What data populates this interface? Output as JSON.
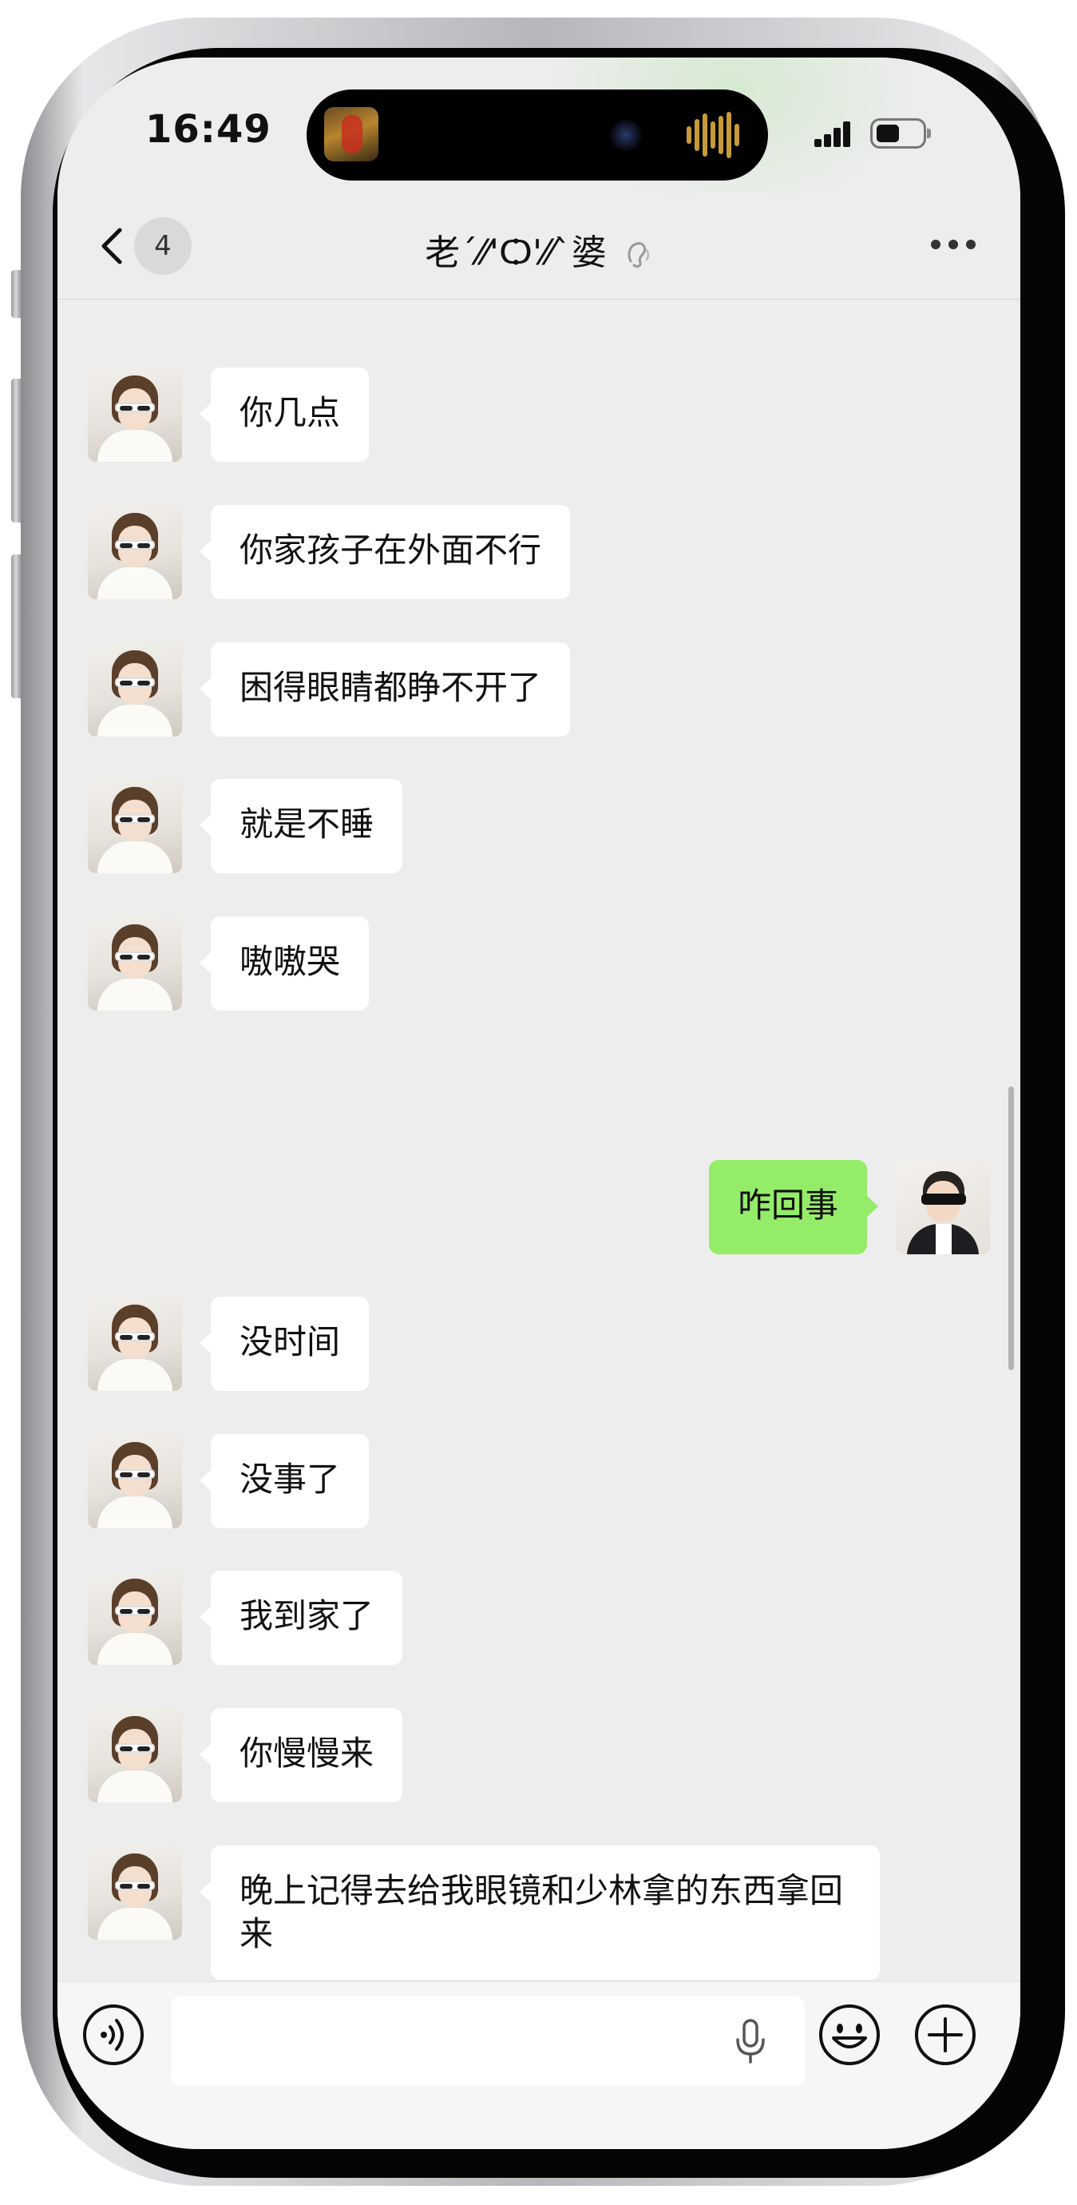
{
  "status_bar": {
    "time": "16:49"
  },
  "nav": {
    "back_count": "4",
    "title": "老ˊ⁄⁄'Ѻ'⁄⁄ˋ婆"
  },
  "messages": [
    {
      "side": "in",
      "text": "你几点"
    },
    {
      "side": "in",
      "text": "你家孩子在外面不行"
    },
    {
      "side": "in",
      "text": "困得眼睛都睁不开了"
    },
    {
      "side": "in",
      "text": "就是不睡"
    },
    {
      "side": "in",
      "text": "嗷嗷哭"
    },
    {
      "side": "out",
      "text": "咋回事"
    },
    {
      "side": "in",
      "text": "没时间"
    },
    {
      "side": "in",
      "text": "没事了"
    },
    {
      "side": "in",
      "text": "我到家了"
    },
    {
      "side": "in",
      "text": "你慢慢来"
    },
    {
      "side": "in",
      "text": "晚上记得去给我眼镜和少林拿的东西拿回来"
    }
  ],
  "input": {
    "value": "",
    "placeholder": ""
  },
  "colors": {
    "background": "#ededed",
    "incoming_bubble": "#ffffff",
    "outgoing_bubble": "#95ec69"
  },
  "icons": [
    "back-chevron-icon",
    "ear-icon",
    "more-icon",
    "voice-icon",
    "microphone-icon",
    "emoji-icon",
    "plus-icon"
  ]
}
